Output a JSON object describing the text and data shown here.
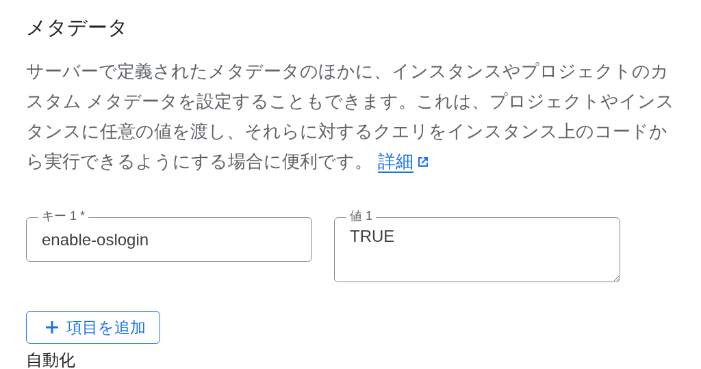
{
  "section": {
    "title": "メタデータ",
    "description": "サーバーで定義されたメタデータのほかに、インスタンスやプロジェクトのカスタム メタデータを設定することもできます。これは、プロジェクトやインスタンスに任意の値を渡し、それらに対するクエリをインスタンス上のコードから実行できるようにする場合に便利です。",
    "link": "詳細"
  },
  "items": [
    {
      "key_label": "キー 1 *",
      "key": "enable-oslogin",
      "value_label": "値 1",
      "value": "TRUE"
    }
  ],
  "add_button": "項目を追加",
  "next_section": {
    "title": "自動化"
  }
}
